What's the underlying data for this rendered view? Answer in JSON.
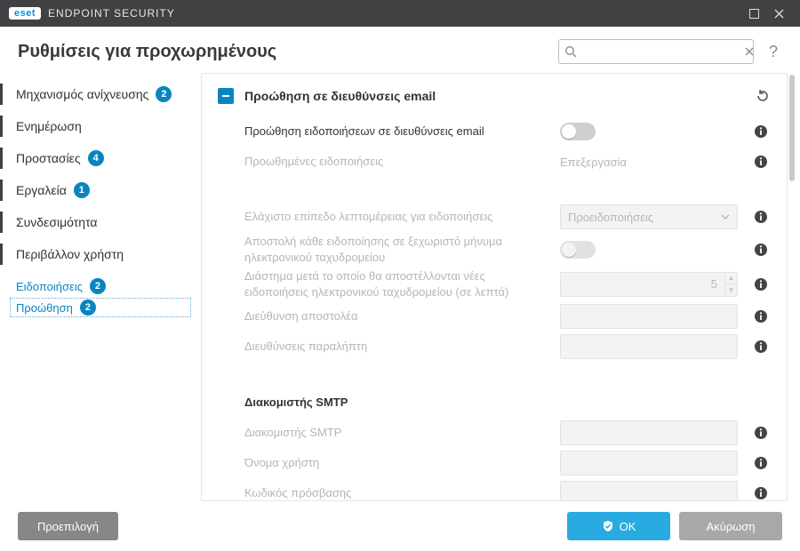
{
  "titlebar": {
    "brand_badge": "eset",
    "brand_text": "ENDPOINT SECURITY"
  },
  "header": {
    "title": "Ρυθμίσεις για προχωρημένους",
    "search_placeholder": "",
    "help": "?"
  },
  "sidebar": {
    "items": [
      {
        "label": "Μηχανισμός ανίχνευσης",
        "badge": "2",
        "top": true
      },
      {
        "label": "Ενημέρωση",
        "badge": null,
        "top": true
      },
      {
        "label": "Προστασίες",
        "badge": "4",
        "top": true
      },
      {
        "label": "Εργαλεία",
        "badge": "1",
        "top": true
      },
      {
        "label": "Συνδεσιμότητα",
        "badge": null,
        "top": true
      },
      {
        "label": "Περιβάλλον χρήστη",
        "badge": null,
        "top": true
      }
    ],
    "sub": [
      {
        "label": "Ειδοποιήσεις",
        "badge": "2",
        "selected": false
      },
      {
        "label": "Προώθηση",
        "badge": "2",
        "selected": true
      }
    ]
  },
  "section": {
    "title": "Προώθηση σε διευθύνσεις email",
    "rows": {
      "forward_enable": "Προώθηση ειδοποιήσεων σε διευθύνσεις email",
      "forwarded": {
        "label": "Προωθημένες ειδοποιήσεις",
        "action": "Επεξεργασία"
      },
      "verbosity": {
        "label": "Ελάχιστο επίπεδο λεπτομέρειας για ειδοποιήσεις",
        "value": "Προειδοποιήσεις"
      },
      "separate": "Αποστολή κάθε ειδοποίησης σε ξεχωριστό μήνυμα ηλεκτρονικού ταχυδρομείου",
      "interval": {
        "label": "Διάστημα μετά το οποίο θα αποστέλλονται νέες ειδοποιήσεις ηλεκτρονικού ταχυδρομείου (σε λεπτά)",
        "value": "5"
      },
      "sender": "Διεύθυνση αποστολέα",
      "recipients": "Διευθύνσεις παραλήπτη"
    },
    "smtp": {
      "title": "Διακομιστής SMTP",
      "server": "Διακομιστής SMTP",
      "user": "Όνομα χρήστη",
      "password": "Κωδικός πρόσβασης"
    }
  },
  "footer": {
    "default": "Προεπιλογή",
    "ok": "ΟΚ",
    "cancel": "Ακύρωση"
  }
}
